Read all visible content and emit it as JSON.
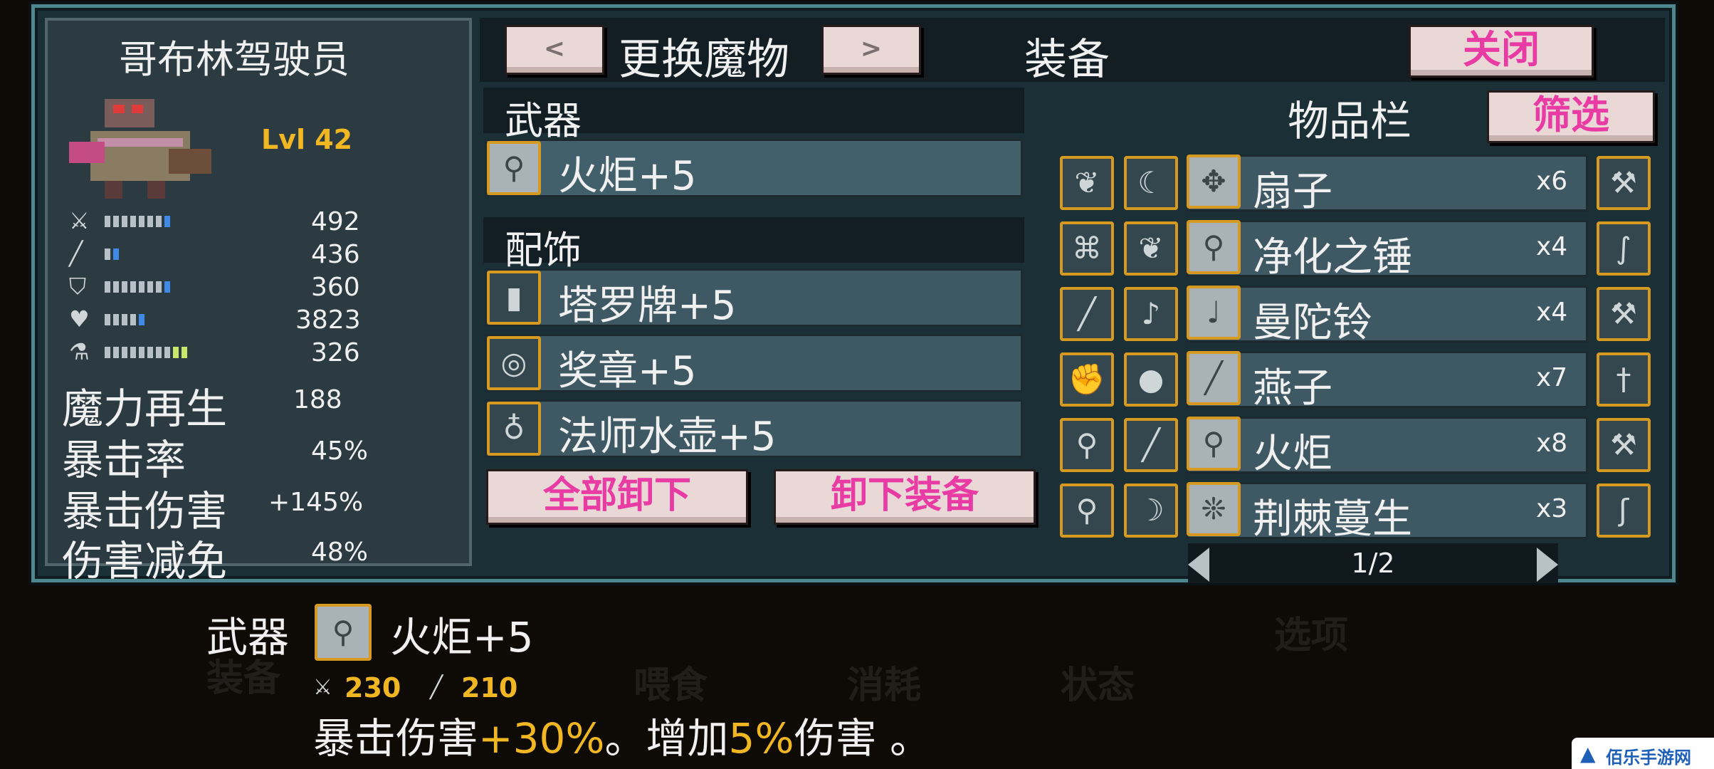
{
  "monster": {
    "name": "哥布林驾驶员",
    "level": "Lvl 42",
    "stats": [
      {
        "icon": "sword-icon",
        "value": "492",
        "bar_fill": 0.8
      },
      {
        "icon": "wand-icon",
        "value": "436",
        "bar_fill": 0.2
      },
      {
        "icon": "shield-icon",
        "value": "360",
        "bar_fill": 0.8
      },
      {
        "icon": "heart-icon",
        "value": "3823",
        "bar_fill": 0.5
      },
      {
        "icon": "potion-icon",
        "value": "326",
        "bar_fill": 1.0
      }
    ],
    "extra_stats": [
      {
        "label": "魔力再生",
        "value": "188"
      },
      {
        "label": "暴击率",
        "value": "45%"
      },
      {
        "label": "暴击伤害",
        "value": "+145%"
      },
      {
        "label": "伤害减免",
        "value": "48%"
      }
    ]
  },
  "header": {
    "prev": "<",
    "switch_label": "更换魔物",
    "next": ">",
    "title": "装备",
    "close": "关闭"
  },
  "equipment": {
    "weapon_header": "武器",
    "weapon": {
      "name": "火炬+5",
      "icon": "torch-icon"
    },
    "accessory_header": "配饰",
    "accessories": [
      {
        "name": "塔罗牌+5",
        "icon": "tarot-card-icon"
      },
      {
        "name": "奖章+5",
        "icon": "medal-icon"
      },
      {
        "name": "法师水壶+5",
        "icon": "flask-icon"
      }
    ],
    "unequip_all": "全部卸下",
    "unequip": "卸下装备"
  },
  "inventory": {
    "title": "物品栏",
    "filter": "筛选",
    "rows": [
      {
        "left1": "leaf-icon",
        "left2": "sickle-icon",
        "item": "扇子",
        "item_icon": "fan-icon",
        "count": "x6",
        "right": "axe-icon"
      },
      {
        "left1": "knot-icon",
        "left2": "leaf-icon",
        "item": "净化之锤",
        "item_icon": "hammer-icon",
        "count": "x4",
        "right": "whip-icon"
      },
      {
        "left1": "dagger-icon",
        "left2": "staff-icon",
        "item": "曼陀铃",
        "item_icon": "mandolin-icon",
        "count": "x4",
        "right": "axe-icon"
      },
      {
        "left1": "gauntlet-icon",
        "left2": "orb-icon",
        "item": "燕子",
        "item_icon": "swallow-blade-icon",
        "count": "x7",
        "right": "sword-icon"
      },
      {
        "left1": "mace-icon",
        "left2": "sword-icon",
        "item": "火炬",
        "item_icon": "torch-icon",
        "count": "x8",
        "right": "hammer-icon"
      },
      {
        "left1": "torch-icon",
        "left2": "horn-icon",
        "item": "荆棘蔓生",
        "item_icon": "thorn-icon",
        "count": "x3",
        "right": "hook-icon"
      }
    ],
    "page": "1/2"
  },
  "detail": {
    "category": "武器",
    "item_name": "火炬+5",
    "item_icon": "torch-icon",
    "attack": "230",
    "magic": "210",
    "desc_prefix": "暴击伤害",
    "desc_value1": "+30%",
    "desc_mid": "。增加",
    "desc_value2": "5%",
    "desc_suffix": "伤害 。"
  },
  "watermark": "佰乐手游网",
  "colors": {
    "accent_pink": "#e83ba4",
    "gold": "#f0b722",
    "frame": "#4f8790"
  }
}
